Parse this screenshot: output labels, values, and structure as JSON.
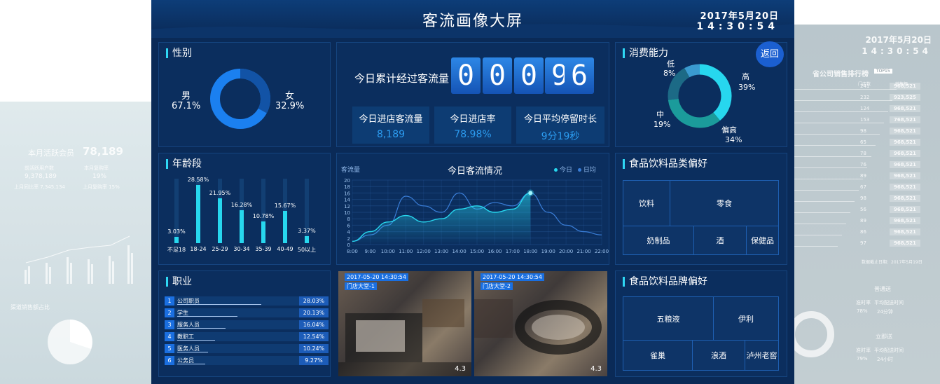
{
  "header": {
    "title": "客流画像大屏",
    "date": "2017年5月20日",
    "time": "14:30:54",
    "back_label": "返回"
  },
  "gender": {
    "title": "性别",
    "male_label": "男",
    "male_pct": "67.1%",
    "female_label": "女",
    "female_pct": "32.9%",
    "male_value": 67.1,
    "female_value": 32.9
  },
  "traffic": {
    "cumulative_label": "今日累计经过客流量",
    "digits": [
      "0",
      "0",
      "0",
      "9",
      "6"
    ],
    "stats": [
      {
        "label": "今日进店客流量",
        "value": "8,189"
      },
      {
        "label": "今日进店率",
        "value": "78.98%"
      },
      {
        "label": "今日平均停留时长",
        "value": "9分19秒"
      }
    ]
  },
  "consumption": {
    "title": "消费能力",
    "segments": [
      {
        "label": "低",
        "pct": "8%",
        "value": 8
      },
      {
        "label": "高",
        "pct": "39%",
        "value": 39
      },
      {
        "label": "偏高",
        "pct": "34%",
        "value": 34
      },
      {
        "label": "中",
        "pct": "19%",
        "value": 19
      }
    ]
  },
  "age": {
    "title": "年龄段",
    "categories": [
      "不足18",
      "18-24",
      "25-29",
      "30-34",
      "35-39",
      "40-49",
      "50以上"
    ],
    "values": [
      3.03,
      28.58,
      21.95,
      16.28,
      10.78,
      15.67,
      3.37
    ],
    "labels": [
      "3.03%",
      "28.58%",
      "21.95%",
      "16.28%",
      "10.78%",
      "15.67%",
      "3.37%"
    ]
  },
  "flow_chart": {
    "title": "今日客流情况",
    "ylabel": "客流量",
    "legend": [
      "今日",
      "日均"
    ],
    "yticks": [
      "20",
      "18",
      "16",
      "14",
      "12",
      "10",
      "8",
      "6",
      "4",
      "2",
      "0"
    ],
    "xticks": [
      "8:00",
      "9:00",
      "10:00",
      "11:00",
      "12:00",
      "13:00",
      "14:00",
      "15:00",
      "16:00",
      "17:00",
      "18:00",
      "19:00",
      "20:00",
      "21:00",
      "22:00"
    ]
  },
  "chart_data": {
    "type": "line",
    "title": "今日客流情况",
    "ylabel": "客流量",
    "ylim": [
      0,
      20
    ],
    "x": [
      "8:00",
      "9:00",
      "10:00",
      "11:00",
      "12:00",
      "13:00",
      "14:00",
      "15:00",
      "16:00",
      "17:00",
      "18:00",
      "19:00",
      "20:00",
      "21:00",
      "22:00"
    ],
    "series": [
      {
        "name": "今日",
        "values": [
          1,
          4,
          7,
          9,
          7,
          8,
          11,
          12,
          10,
          11,
          16,
          null,
          null,
          null,
          null
        ]
      },
      {
        "name": "日均",
        "values": [
          1,
          3,
          6,
          15,
          12,
          10,
          16,
          11,
          13,
          12,
          16,
          10,
          6,
          4,
          3
        ]
      }
    ]
  },
  "jobs": {
    "title": "职业",
    "items": [
      {
        "num": "1",
        "name": "公司职员",
        "pct": "28.03%",
        "value": 28.03
      },
      {
        "num": "2",
        "name": "学生",
        "pct": "20.13%",
        "value": 20.13
      },
      {
        "num": "3",
        "name": "服务人员",
        "pct": "16.04%",
        "value": 16.04
      },
      {
        "num": "4",
        "name": "教职工",
        "pct": "12.54%",
        "value": 12.54
      },
      {
        "num": "5",
        "name": "医务人员",
        "pct": "10.24%",
        "value": 10.24
      },
      {
        "num": "6",
        "name": "公务员",
        "pct": "9.27%",
        "value": 9.27
      }
    ]
  },
  "cameras": [
    {
      "time": "2017-05-20 14:30:54",
      "name": "门店大堂-1",
      "num": "4.3"
    },
    {
      "time": "2017-05-20 14:30:54",
      "name": "门店大堂-2",
      "num": "4.3"
    }
  ],
  "food_category": {
    "title": "食品饮料品类偏好",
    "items": [
      "饮料",
      "零食",
      "奶制品",
      "酒",
      "保健品"
    ]
  },
  "food_brand": {
    "title": "食品饮料品牌偏好",
    "items": [
      "五粮液",
      "伊利",
      "雀巢",
      "浪酒",
      "泸州老窖"
    ]
  },
  "bg_right": {
    "date": "2017年5月20日",
    "time": "14:30:54",
    "title": "省公司销售排行榜",
    "badge": "TOP15",
    "col1": "门店数",
    "col2": "销售额",
    "rows": [
      [
        "241",
        "968,521"
      ],
      [
        "232",
        "923,525"
      ],
      [
        "124",
        "968,521"
      ],
      [
        "153",
        "768,521"
      ],
      [
        "98",
        "968,521"
      ],
      [
        "65",
        "968,521"
      ],
      [
        "78",
        "968,521"
      ],
      [
        "76",
        "968,521"
      ],
      [
        "89",
        "968,521"
      ],
      [
        "67",
        "968,521"
      ],
      [
        "98",
        "968,521"
      ],
      [
        "56",
        "968,521"
      ],
      [
        "89",
        "968,521"
      ],
      [
        "86",
        "968,521"
      ],
      [
        "97",
        "968,521"
      ]
    ],
    "footer": "数据截止日期：2017年5月19日",
    "sec1": "普通送",
    "sec1_a": "准时率",
    "sec1_b": "平均配送时间",
    "sec1_av": "78%",
    "sec1_bv": "24分钟",
    "sec2": "立即送",
    "sec2_a": "准时率",
    "sec2_b": "平均配送时间",
    "sec2_av": "79%",
    "sec2_bv": "24小时"
  },
  "bg_left": {
    "active_label": "本月活跃会员",
    "active_value": "78,189",
    "m1": "前活跃用户数",
    "m1v": "9,378,189",
    "m2": "本月复购率",
    "m2v": "19%",
    "m3": "上月同比率 7,345,134",
    "m4": "上月复购率 15%",
    "channel_title": "渠道销售额占比"
  }
}
